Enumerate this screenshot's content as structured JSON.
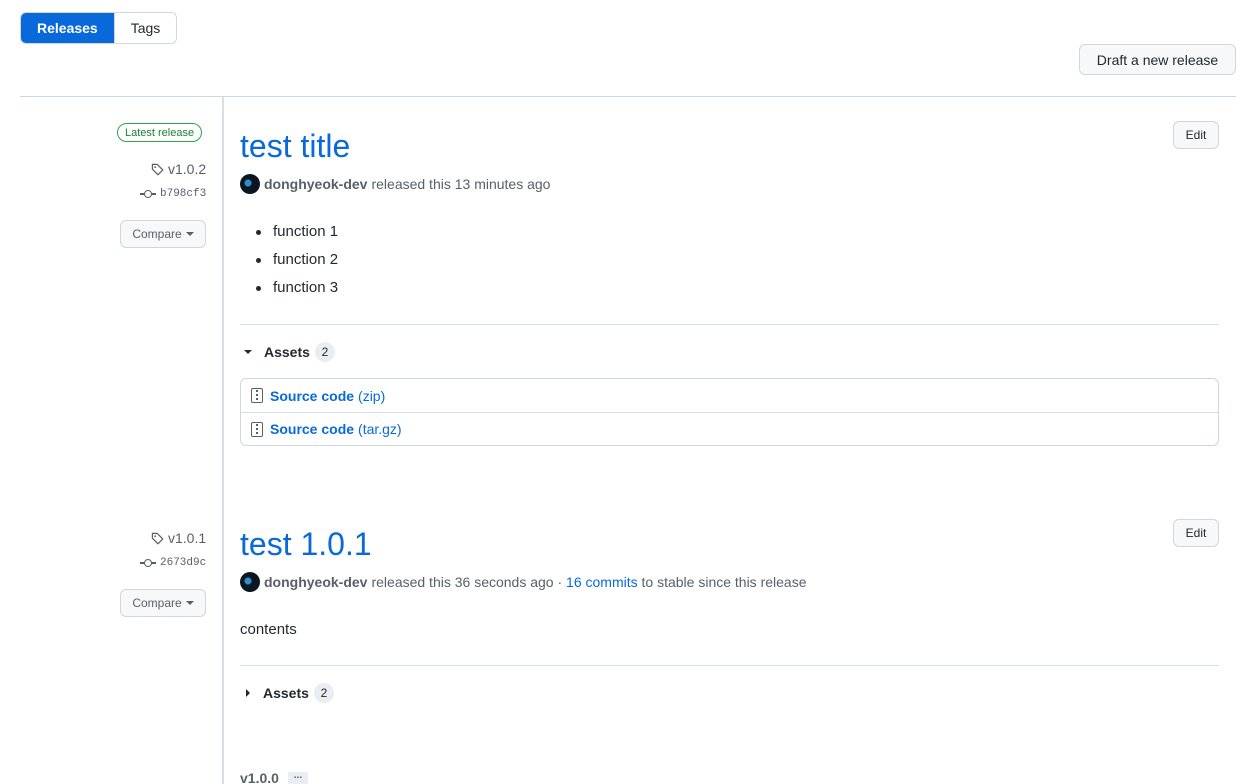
{
  "tabs": {
    "releases": "Releases",
    "tags": "Tags"
  },
  "header": {
    "draft_button": "Draft a new release"
  },
  "releases": [
    {
      "latest_badge": "Latest release",
      "tag": "v1.0.2",
      "commit": "b798cf3",
      "compare_label": "Compare",
      "title": "test title",
      "edit_label": "Edit",
      "author": "donghyeok-dev",
      "released_text": "released this 13 minutes ago",
      "notes": [
        "function 1",
        "function 2",
        "function 3"
      ],
      "assets_label": "Assets",
      "assets_count": "2",
      "assets_expanded": true,
      "assets": [
        {
          "name": "Source code",
          "ext": "(zip)"
        },
        {
          "name": "Source code",
          "ext": "(tar.gz)"
        }
      ]
    },
    {
      "tag": "v1.0.1",
      "commit": "2673d9c",
      "compare_label": "Compare",
      "title": "test 1.0.1",
      "edit_label": "Edit",
      "author": "donghyeok-dev",
      "released_text": "released this 36 seconds ago",
      "separator": " · ",
      "commits_link": "16 commits",
      "commits_suffix": " to stable since this release",
      "body": "contents",
      "assets_label": "Assets",
      "assets_count": "2",
      "assets_expanded": false
    },
    {
      "tag": "v1.0.0",
      "ellipsis": "..."
    }
  ],
  "colors": {
    "accent": "#0969da",
    "latest_badge": "#1a7f37"
  }
}
